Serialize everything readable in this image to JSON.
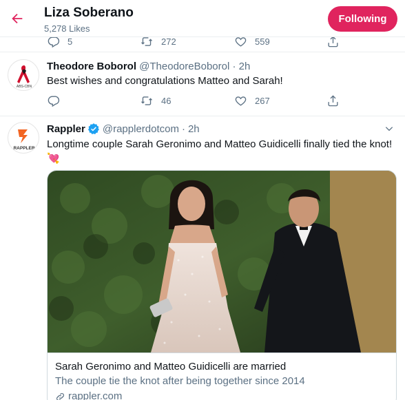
{
  "header": {
    "title": "Liza Soberano",
    "subtitle": "5,278 Likes",
    "follow_label": "Following"
  },
  "prev_tweet": {
    "replies": "5",
    "retweets": "272",
    "likes": "559"
  },
  "tweets": [
    {
      "name": "Theodore Boborol",
      "handle": "@TheodoreBoborol",
      "dot": "·",
      "time": "2h",
      "text": "Best wishes and congratulations Matteo and Sarah!",
      "replies": "",
      "retweets": "46",
      "likes": "267",
      "avatar_label": "ABS-CBN"
    },
    {
      "name": "Rappler",
      "handle": "@rapplerdotcom",
      "dot": "·",
      "time": "2h",
      "text": "Longtime couple Sarah Geronimo and Matteo Guidicelli finally tied the knot!",
      "emoji": "💘",
      "avatar_label": "RAPPLER",
      "verified": true,
      "card": {
        "title": "Sarah Geronimo and Matteo Guidicelli are married",
        "description": "The couple tie the knot after being together since 2014",
        "domain": "rappler.com"
      }
    }
  ],
  "colors": {
    "accent": "#e0245e",
    "twitter_blue": "#1da1f2",
    "muted": "#5b7083",
    "border": "#ebeef0"
  },
  "icons": [
    "back-arrow-icon",
    "reply-icon",
    "retweet-icon",
    "like-icon",
    "share-icon",
    "caret-down-icon",
    "verified-icon",
    "link-icon"
  ]
}
